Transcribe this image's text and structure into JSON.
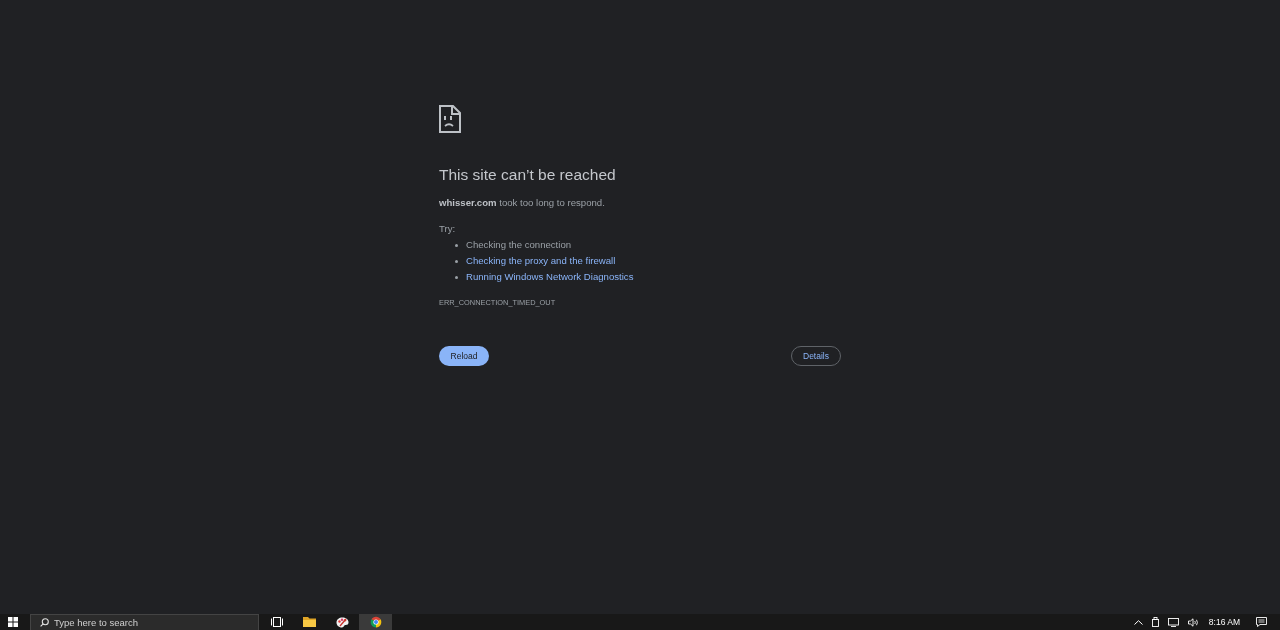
{
  "error_page": {
    "title": "This site can’t be reached",
    "message": "**whisser.com** took too long to respond.",
    "try_label": "Try:",
    "suggestions": [
      {
        "kind": "text",
        "text": "Checking the connection"
      },
      {
        "kind": "link",
        "text": "Checking the proxy and the firewall"
      },
      {
        "kind": "link",
        "text": "Running Windows Network Diagnostics"
      }
    ],
    "error_code": "ERR_CONNECTION_TIMED_OUT",
    "buttons": [
      {
        "kind": "primary",
        "label": "Reload"
      },
      {
        "kind": "secondary",
        "label": "Details"
      }
    ]
  },
  "taskbar": {
    "search": {
      "placeholder": "Type here to search"
    },
    "apps": [
      {
        "kind": "task_view",
        "selected": false
      },
      {
        "kind": "folder",
        "selected": false
      },
      {
        "kind": "palette",
        "selected": false
      },
      {
        "kind": "browser",
        "selected": true
      }
    ],
    "clock": {
      "time": "8:16 AM"
    }
  }
}
